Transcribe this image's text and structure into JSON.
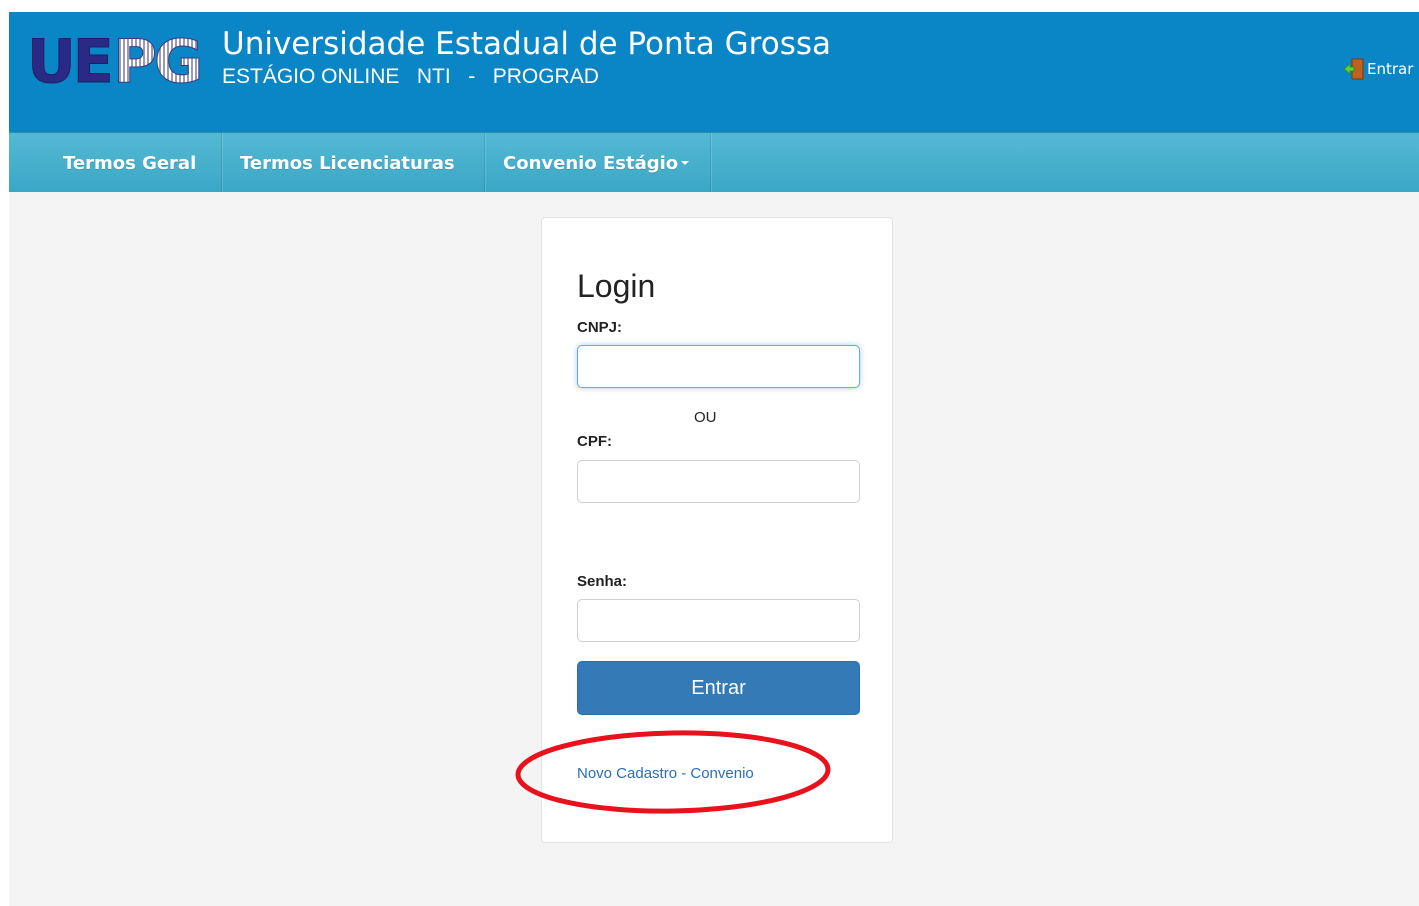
{
  "header": {
    "logo_text": "UEPG",
    "title": "Universidade Estadual de Ponta Grossa",
    "subtitle": "ESTÁGIO ONLINE   NTI   -   PROGRAD",
    "login_link": "Entrar"
  },
  "nav": {
    "items": [
      {
        "label": "Termos Geral"
      },
      {
        "label": "Termos Licenciaturas"
      },
      {
        "label": "Convenio Estágio"
      }
    ]
  },
  "login": {
    "title": "Login",
    "cnpj_label": "CNPJ:",
    "cnpj_value": "",
    "or_text": "OU",
    "cpf_label": "CPF:",
    "cpf_value": "",
    "password_label": "Senha:",
    "password_value": "",
    "submit_label": "Entrar",
    "register_link": "Novo Cadastro - Convenio"
  },
  "colors": {
    "header": "#0a86c6",
    "navbar": "#46afcd",
    "button": "#337ab7",
    "link": "#2a6fb5",
    "annotation": "#e8121c"
  }
}
